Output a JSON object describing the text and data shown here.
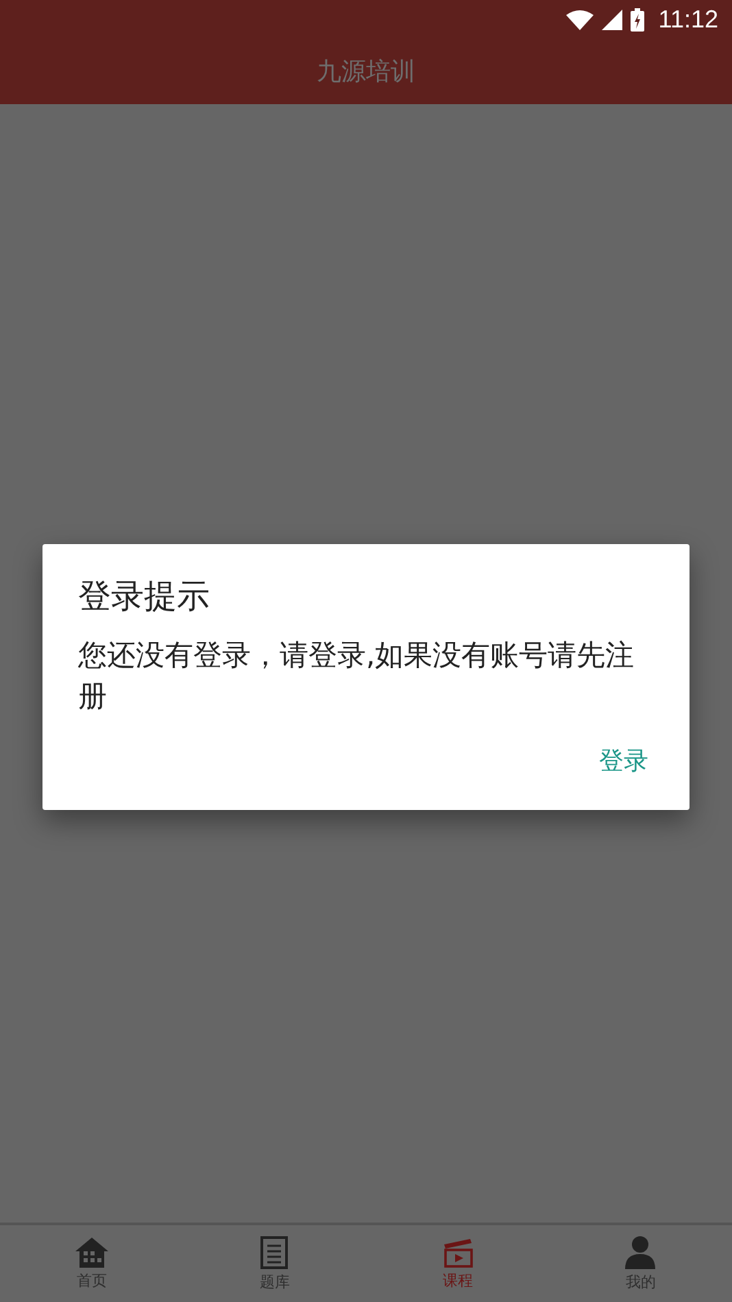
{
  "status_bar": {
    "time": "11:12"
  },
  "app_bar": {
    "title": "九源培训"
  },
  "dialog": {
    "title": "登录提示",
    "message": "您还没有登录，请登录,如果没有账号请先注册",
    "buttons": [
      "登录"
    ]
  },
  "bottom_nav": [
    {
      "label": "首页",
      "kind": "home",
      "selected": false
    },
    {
      "label": "题库",
      "kind": "list",
      "selected": false
    },
    {
      "label": "课程",
      "kind": "video",
      "selected": true
    },
    {
      "label": "我的",
      "kind": "person",
      "selected": false
    }
  ]
}
